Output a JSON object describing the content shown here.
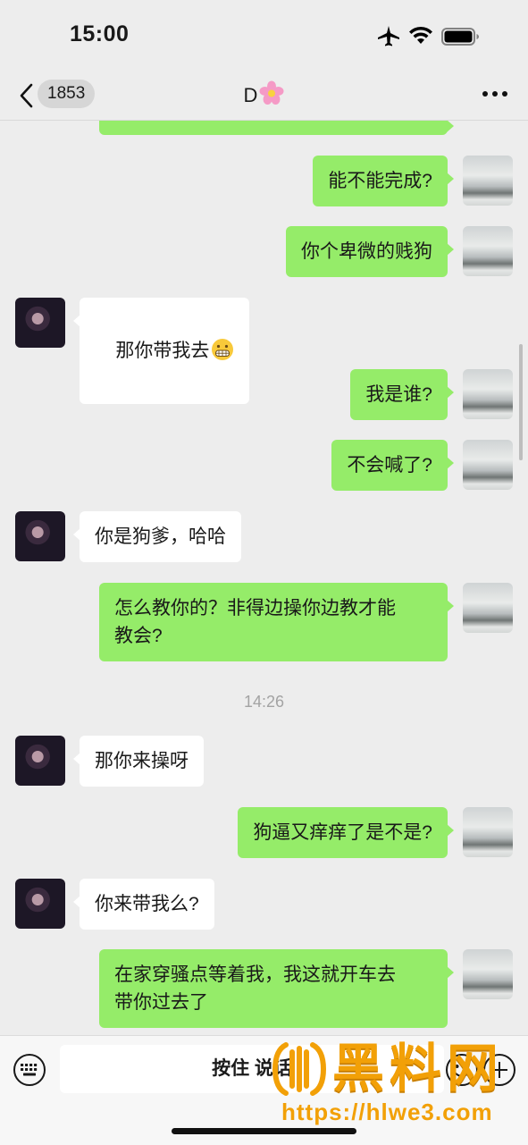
{
  "status_bar": {
    "time": "15:00",
    "icons": [
      "airplane-icon",
      "wifi-icon",
      "battery-icon"
    ]
  },
  "nav": {
    "back_icon": "chevron-left-icon",
    "unread_count": "1853",
    "contact_name": "D",
    "contact_emoji": "flower-icon",
    "more_icon": "more-dots-icon"
  },
  "messages": [
    {
      "from": "me",
      "text": ""
    },
    {
      "from": "me",
      "text": "能不能完成?"
    },
    {
      "from": "me",
      "text": "你个卑微的贱狗"
    },
    {
      "from": "them",
      "text": "那你带我去"
    },
    {
      "from": "me",
      "text": "我是谁?"
    },
    {
      "from": "me",
      "text": "不会喊了?"
    },
    {
      "from": "them",
      "text": "你是狗爹，哈哈"
    },
    {
      "from": "me",
      "text": "怎么教你的？非得边操你边教才能\n教会?"
    },
    {
      "from": "them",
      "text": "那你来操呀"
    },
    {
      "from": "me",
      "text": "狗逼又痒痒了是不是?"
    },
    {
      "from": "them",
      "text": "你来带我么?"
    },
    {
      "from": "me",
      "text": "在家穿骚点等着我，我这就开车去\n带你过去了"
    }
  ],
  "timestamp": "14:26",
  "input_bar": {
    "keyboard_icon": "keyboard-icon",
    "hold_to_talk_label": "按住 说话",
    "emoji_icon": "smiley-icon",
    "plus_icon": "plus-circle-icon"
  },
  "watermark": {
    "brand": "黑料网",
    "url": "https://hlwe3.com"
  },
  "colors": {
    "background": "#ededed",
    "my_bubble": "#95ec69",
    "their_bubble": "#ffffff",
    "watermark": "#f2a007"
  }
}
